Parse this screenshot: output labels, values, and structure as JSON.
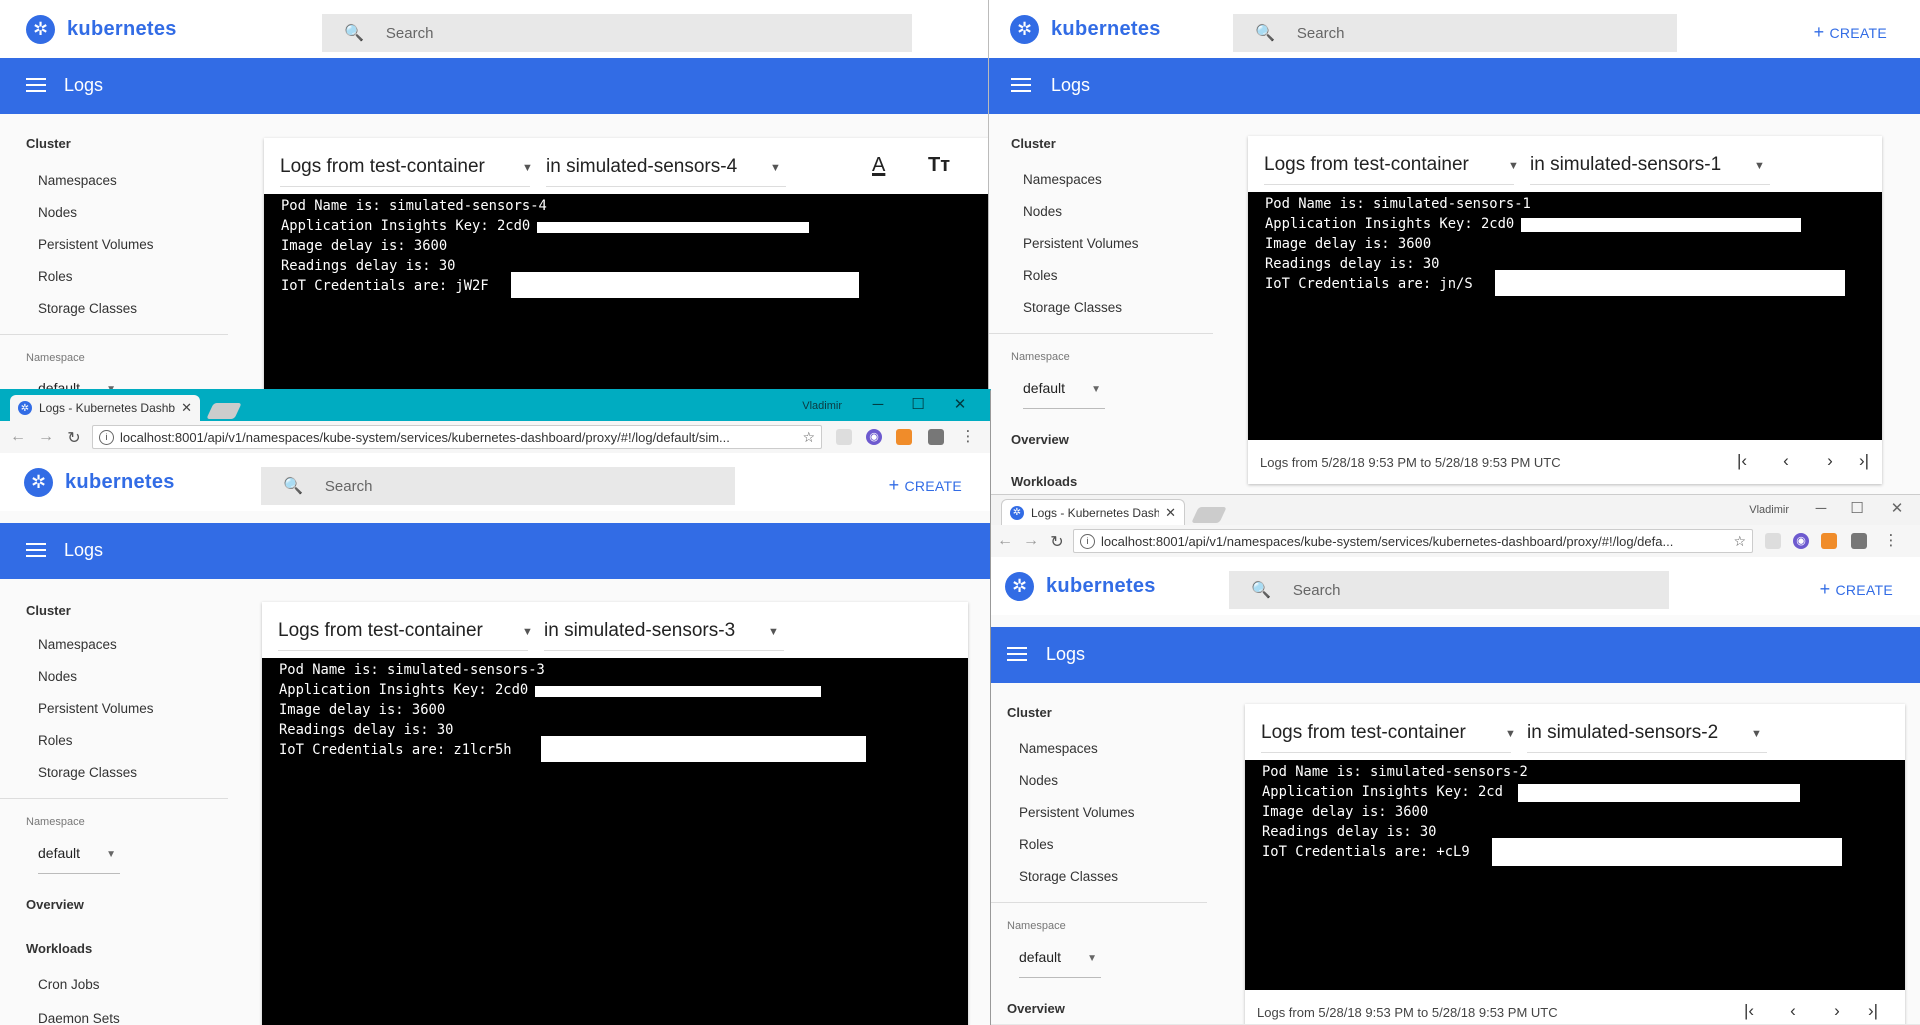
{
  "app": {
    "brand": "kubernetes",
    "search_placeholder": "Search",
    "create_label": "CREATE",
    "page_title": "Logs"
  },
  "chrome": {
    "tab_title": "Logs - Kubernetes Dashb",
    "user": "Vladimir",
    "url_w3": "localhost:8001/api/v1/namespaces/kube-system/services/kubernetes-dashboard/proxy/#!/log/default/sim...",
    "url_w4": "localhost:8001/api/v1/namespaces/kube-system/services/kubernetes-dashboard/proxy/#!/log/defa..."
  },
  "sidebar": {
    "cluster": "Cluster",
    "items": [
      "Namespaces",
      "Nodes",
      "Persistent Volumes",
      "Roles",
      "Storage Classes"
    ],
    "namespace_label": "Namespace",
    "namespace_value": "default",
    "overview": "Overview",
    "workloads": "Workloads",
    "workload_items": [
      "Cron Jobs",
      "Daemon Sets"
    ]
  },
  "logs": {
    "container_select": "Logs from test-container",
    "footer": "Logs from 5/28/18 9:53 PM to 5/28/18 9:53 PM UTC",
    "w1": {
      "pod_select": "in simulated-sensors-4",
      "lines": [
        "Pod Name is: simulated-sensors-4",
        "Application Insights Key: 2cd0",
        "Image delay is: 3600",
        "Readings delay is: 30",
        "IoT Credentials are: jW2F"
      ]
    },
    "w2": {
      "pod_select": "in simulated-sensors-1",
      "lines": [
        "Pod Name is: simulated-sensors-1",
        "Application Insights Key: 2cd0",
        "Image delay is: 3600",
        "Readings delay is: 30",
        "IoT Credentials are: jn/S"
      ]
    },
    "w3": {
      "pod_select": "in simulated-sensors-3",
      "lines": [
        "Pod Name is: simulated-sensors-3",
        "Application Insights Key: 2cd0",
        "Image delay is: 3600",
        "Readings delay is: 30",
        "IoT Credentials are: z1lcr5h"
      ]
    },
    "w4": {
      "pod_select": "in simulated-sensors-2",
      "lines": [
        "Pod Name is: simulated-sensors-2",
        "Application Insights Key: 2cd",
        "Image delay is: 3600",
        "Readings delay is: 30",
        "IoT Credentials are: +cL9"
      ]
    }
  }
}
